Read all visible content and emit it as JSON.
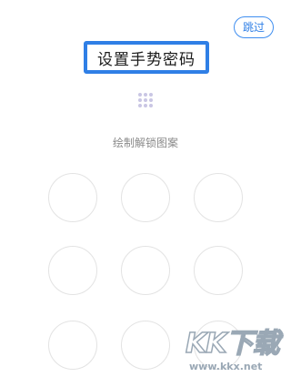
{
  "header": {
    "skip_label": "跳过"
  },
  "title": "设置手势密码",
  "instruction": "绘制解锁图案",
  "pattern": {
    "rows": 3,
    "cols": 3,
    "dot_color": "#c9c6e4",
    "node_border_color": "#e3e3e3"
  },
  "accent_color": "#2f7fe6",
  "watermark": {
    "logo": "KK下载",
    "url": "www.kkx.net"
  }
}
